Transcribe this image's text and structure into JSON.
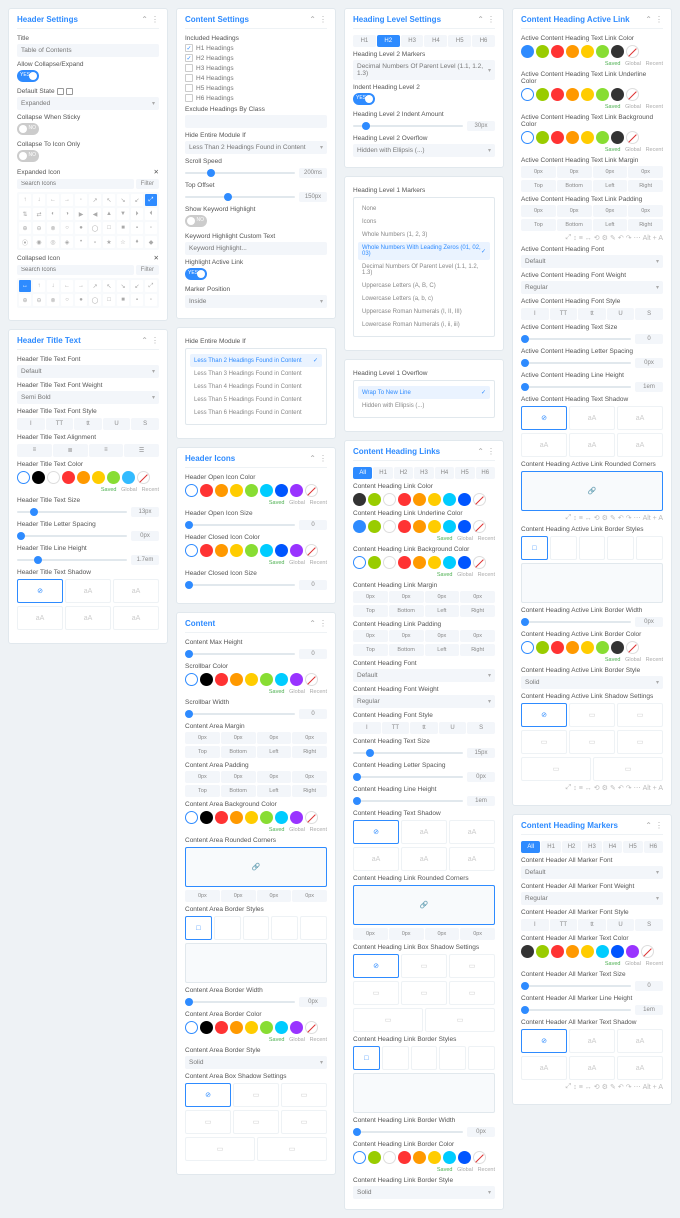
{
  "p": {
    "hs": {
      "t": "Header Settings",
      "f": [
        "Title",
        "Allow Collapse/Expand",
        "Default State",
        "Collapse When Sticky",
        "Collapse To Icon Only",
        "Expanded Icon",
        "Collapsed Icon"
      ],
      "title_val": "Table of Contents",
      "def": "Expanded"
    },
    "htt": {
      "t": "Header Title Text",
      "f": [
        "Header Title Text Font",
        "Header Title Text Font Weight",
        "Header Title Text Font Style",
        "Header Title Text Alignment",
        "Header Title Text Color",
        "Header Title Text Size",
        "Header Title Letter Spacing",
        "Header Title Line Height",
        "Header Title Text Shadow"
      ],
      "font": "Default",
      "wt": "Semi Bold"
    },
    "cs": {
      "t": "Content Settings",
      "f": [
        "Included Headings",
        "Exclude Headings By Class",
        "Hide Entire Module If",
        "Scroll Speed",
        "Top Offset",
        "Show Keyword Highlight",
        "Keyword Highlight Custom Text",
        "Highlight Active Link",
        "Marker Position"
      ],
      "h": [
        "H1 Headings",
        "H2 Headings",
        "H3 Headings",
        "H4 Headings",
        "H5 Headings",
        "H6 Headings"
      ],
      "hide": "Less Than 2 Headings Found in Content",
      "kh": "Keyword Highlight...",
      "mp": "Inside"
    },
    "hide2": {
      "t": "Hide Entire Module If",
      "o": [
        "Less Than 2 Headings Found in Content",
        "Less Than 3 Headings Found in Content",
        "Less Than 4 Headings Found in Content",
        "Less Than 5 Headings Found in Content",
        "Less Than 6 Headings Found in Content"
      ]
    },
    "hi": {
      "t": "Header Icons",
      "f": [
        "Header Open Icon Color",
        "Header Open Icon Size",
        "Header Closed Icon Color",
        "Header Closed Icon Size"
      ]
    },
    "ct": {
      "t": "Content",
      "f": [
        "Content Max Height",
        "Scrollbar Color",
        "Scrollbar Width",
        "Content Area Margin",
        "Content Area Padding",
        "Content Area Background Color",
        "Content Area Rounded Corners",
        "Content Area Border Styles",
        "Content Area Border Width",
        "Content Area Border Color",
        "Content Area Border Style",
        "Content Area Box Shadow Settings"
      ],
      "bs": "Solid"
    },
    "hls": {
      "t": "Heading Level Settings",
      "f": [
        "Heading Level 2 Markers",
        "Indent Heading Level 2",
        "Heading Level 2 Indent Amount",
        "Heading Level 2 Overflow"
      ],
      "mk": "Decimal Numbers Of Parent Level (1.1, 1.2, 1.3)",
      "ov": "Hidden with Ellipsis (...)"
    },
    "mk1": {
      "t": "Heading Level 1 Markers",
      "o": [
        "None",
        "Icons",
        "Whole Numbers (1, 2, 3)",
        "Whole Numbers With Leading Zeros (01, 02, 03)",
        "Decimal Numbers Of Parent Level (1.1, 1.2, 1.3)",
        "Uppercase Letters (A, B, C)",
        "Lowercase Letters (a, b, c)",
        "Uppercase Roman Numerals (I, II, III)",
        "Lowercase Roman Numerals (i, ii, iii)"
      ]
    },
    "ov1": {
      "t": "Heading Level 1 Overflow",
      "o": [
        "Wrap To New Line",
        "Hidden with Ellipsis (...)"
      ]
    },
    "chl": {
      "t": "Content Heading Links",
      "f": [
        "Content Heading Link Color",
        "Content Heading Link Underline Color",
        "Content Heading Link Background Color",
        "Content Heading Link Margin",
        "Content Heading Link Padding",
        "Content Heading Font",
        "Content Heading Font Weight",
        "Content Heading Font Style",
        "Content Heading Text Size",
        "Content Heading Letter Spacing",
        "Content Heading Line Height",
        "Content Heading Text Shadow",
        "Content Heading Link Rounded Corners",
        "Content Heading Link Box Shadow Settings",
        "Content Heading Link Border Styles",
        "Content Heading Link Border Width",
        "Content Heading Link Border Color",
        "Content Heading Link Border Style"
      ],
      "font": "Default",
      "wt": "Regular",
      "bs": "Solid"
    },
    "cha": {
      "t": "Content Heading Active Link",
      "f": [
        "Active Content Heading Text Link Color",
        "Active Content Heading Text Link Underline Color",
        "Active Content Heading Text Link Background Color",
        "Active Content Heading Text Link Margin",
        "Active Content Heading Text Link Padding",
        "Active Content Heading Font",
        "Active Content Heading Font Weight",
        "Active Content Heading Font Style",
        "Active Content Heading Text Size",
        "Active Content Heading Letter Spacing",
        "Active Content Heading Line Height",
        "Active Content Heading Text Shadow",
        "Content Heading Active Link Rounded Corners",
        "Content Heading Active Link Border Styles",
        "Content Heading Active Link Border Width",
        "Content Heading Active Link Border Color",
        "Content Heading Active Link Border Style",
        "Content Heading Active Link Shadow Settings"
      ],
      "font": "Default",
      "wt": "Regular",
      "bs": "Solid"
    },
    "chm": {
      "t": "Content Heading Markers",
      "f": [
        "Content Header All Marker Font",
        "Content Header All Marker Font Weight",
        "Content Header All Marker Font Style",
        "Content Header All Marker Text Color",
        "Content Header All Marker Text Size",
        "Content Header All Marker Line Height",
        "Content Header All Marker Text Shadow"
      ],
      "font": "Default",
      "wt": "Regular"
    }
  },
  "side": [
    "Top",
    "Bottom",
    "Left",
    "Right"
  ],
  "hlvl": [
    "All",
    "H1",
    "H2",
    "H3",
    "H4",
    "H5",
    "H6"
  ],
  "pal1": [
    "#000",
    "#fff",
    "#f33",
    "#f90",
    "#fc0",
    "#8d3",
    "#3bf",
    "#c5f"
  ],
  "pal2": [
    "#f33",
    "#f90",
    "#fc0",
    "#8d3",
    "#0cf",
    "#05f",
    "#93f",
    "#333"
  ],
  "sub": [
    "Saved",
    "Global",
    "Recent"
  ],
  "tb": [
    "⤢",
    "↕",
    "≡",
    "↔",
    "⟲",
    "⚙",
    "✎",
    "↶",
    "↷",
    "⋯",
    "Alt + A"
  ],
  "search": "Search Icons",
  "filter": "Filter"
}
